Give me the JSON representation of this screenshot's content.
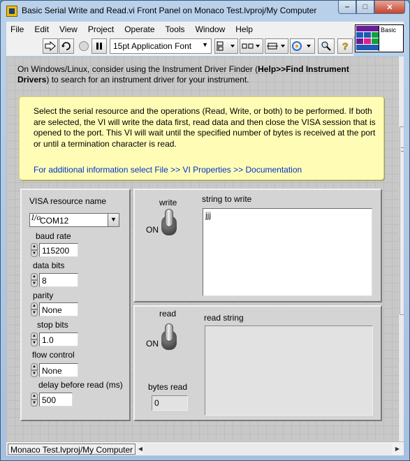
{
  "window": {
    "title": "Basic Serial Write and Read.vi Front Panel on Monaco Test.lvproj/My Computer",
    "min_glyph": "–",
    "max_glyph": "□",
    "close_glyph": "✕"
  },
  "menu": [
    "File",
    "Edit",
    "View",
    "Project",
    "Operate",
    "Tools",
    "Window",
    "Help"
  ],
  "toolbar": {
    "font_label": "15pt Application Font",
    "font_arrow": "▼"
  },
  "vi_icon": {
    "label": "Basic"
  },
  "notes": {
    "top_prefix": "On Windows/Linux, consider using the Instrument Driver Finder (",
    "top_bold": "Help>>Find Instrument Drivers",
    "top_suffix": ") to search for an instrument driver for your instrument.",
    "description": "Select the serial resource and the operations (Read, Write, or both) to be performed.  If both are selected, the VI will write the data first, read data and then close the VISA session that is opened to the port.  This VI will wait until the specified number of bytes is received at the port or until a termination character is read.",
    "link": "For additional information select File >> VI Properties >> Documentation"
  },
  "config": {
    "visa_label": "VISA resource name",
    "visa_value": "COM12",
    "baud_label": "baud rate",
    "baud_value": "115200",
    "databits_label": "data bits",
    "databits_value": "8",
    "parity_label": "parity",
    "parity_value": "None",
    "stopbits_label": "stop bits",
    "stopbits_value": "1.0",
    "flow_label": "flow control",
    "flow_value": "None",
    "delay_label": "delay before read (ms)",
    "delay_value": "500"
  },
  "write": {
    "label": "write",
    "state": "ON",
    "string_label": "string to write",
    "string_value": "jjj"
  },
  "read": {
    "label": "read",
    "state": "ON",
    "string_label": "read string",
    "string_value": "",
    "bytes_label": "bytes read",
    "bytes_value": "0"
  },
  "status": {
    "path": "Monaco Test.lvproj/My Computer"
  },
  "colors": {
    "panel_bg": "#c8c8c8",
    "note_bg": "#fffdb5",
    "link": "#0032c8",
    "close_button": "#c7432d"
  }
}
